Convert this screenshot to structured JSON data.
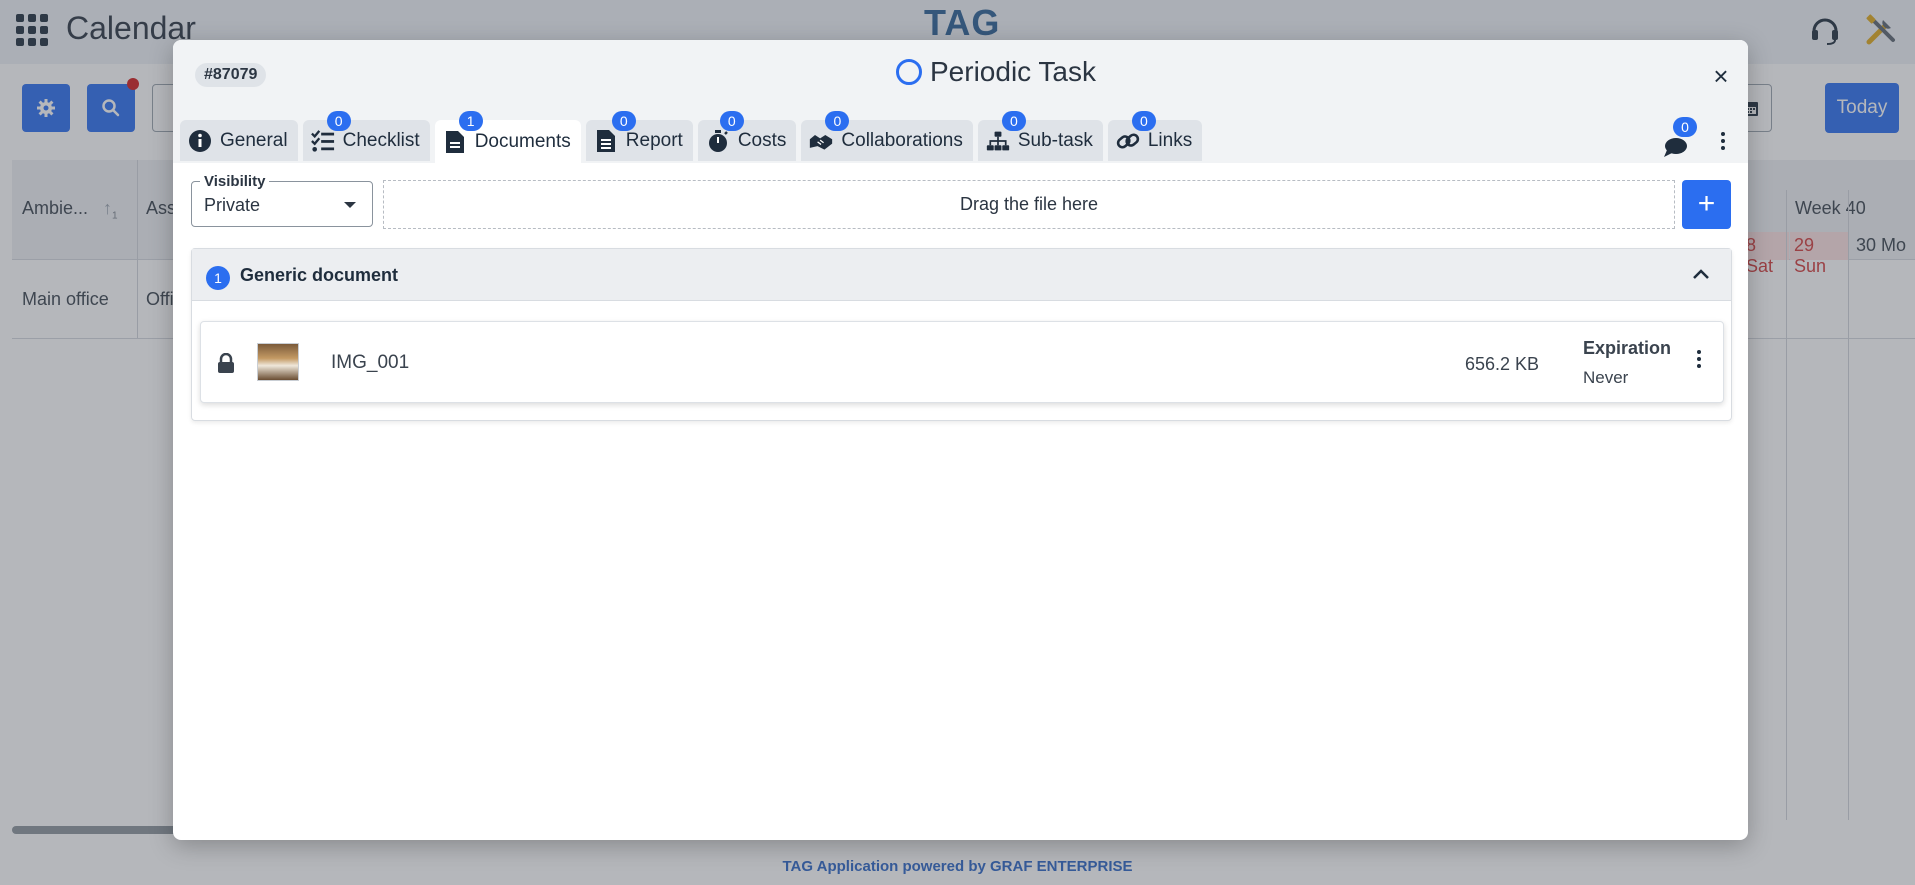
{
  "app": {
    "title": "Calendar",
    "brand": "TAG",
    "today_label": "Today",
    "footer": "TAG Application powered by GRAF ENTERPRISE"
  },
  "grid": {
    "columns": [
      "Ambie...",
      "Ass"
    ],
    "sort_index": "1",
    "rows": [
      {
        "ambient": "Main office",
        "assigned": "Offi"
      }
    ],
    "week_label": "Week 40",
    "days": [
      {
        "label": "8 Sat",
        "weekend": true
      },
      {
        "label": "29 Sun",
        "weekend": true
      },
      {
        "label": "30 Mo",
        "weekend": false
      }
    ]
  },
  "modal": {
    "task_id": "#87079",
    "title": "Periodic Task",
    "close": "×",
    "tabs": [
      {
        "label": "General",
        "icon": "info-icon",
        "count": null
      },
      {
        "label": "Checklist",
        "icon": "checklist-icon",
        "count": "0"
      },
      {
        "label": "Documents",
        "icon": "document-icon",
        "count": "1",
        "active": true
      },
      {
        "label": "Report",
        "icon": "report-icon",
        "count": "0"
      },
      {
        "label": "Costs",
        "icon": "stopwatch-icon",
        "count": "0"
      },
      {
        "label": "Collaborations",
        "icon": "handshake-icon",
        "count": "0"
      },
      {
        "label": "Sub-task",
        "icon": "sitemap-icon",
        "count": "0"
      },
      {
        "label": "Links",
        "icon": "link-icon",
        "count": "0"
      }
    ],
    "comments_count": "0",
    "visibility": {
      "label": "Visibility",
      "value": "Private"
    },
    "drop_zone": "Drag the file here",
    "add_label": "+",
    "group": {
      "count": "1",
      "title": "Generic document",
      "documents": [
        {
          "name": "IMG_001",
          "size": "656.2 KB",
          "expiration_label": "Expiration",
          "expiration_value": "Never"
        }
      ]
    }
  },
  "colors": {
    "accent": "#2b6ef0",
    "weekend_bg": "#fde1e1",
    "weekend_text": "#d23b3b",
    "brand": "#2a5f94"
  }
}
